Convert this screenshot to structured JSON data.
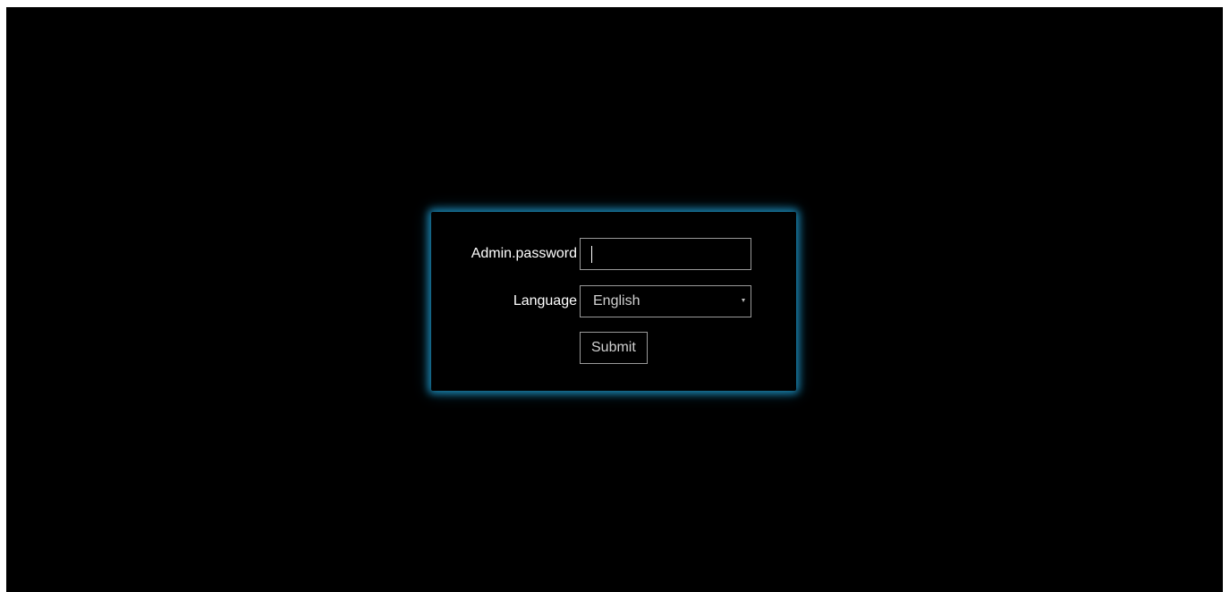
{
  "login": {
    "password_label": "Admin.password",
    "password_value": "",
    "language_label": "Language",
    "language_selected": "English",
    "submit_label": "Submit"
  },
  "colors": {
    "background": "#000000",
    "panel_glow": "#1e96c8",
    "text": "#ffffff",
    "field_border": "#9a9a9a"
  },
  "icons": {
    "language_dropdown": "chevron-down-icon"
  }
}
